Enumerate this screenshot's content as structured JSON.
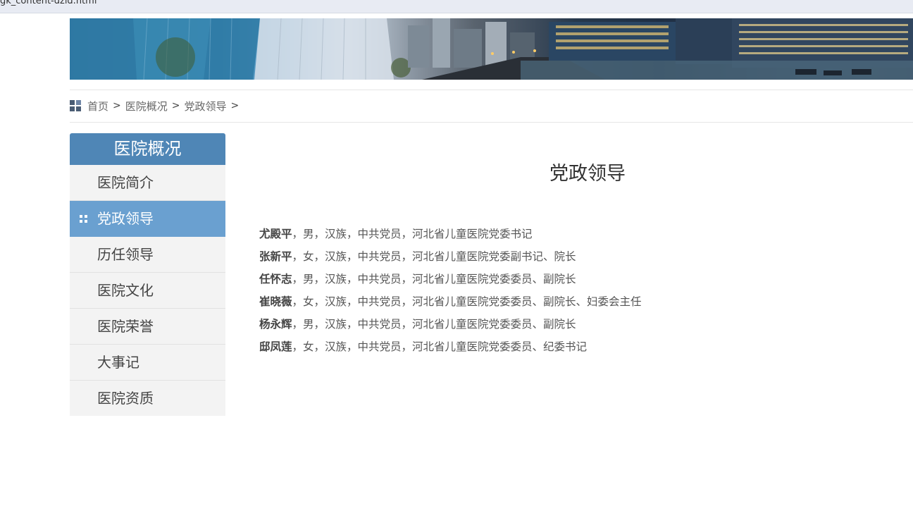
{
  "browser": {
    "url_text": "gk_content-dzld.html"
  },
  "breadcrumb": {
    "items": [
      "首页",
      "医院概况",
      "党政领导"
    ],
    "separator": ">"
  },
  "sidebar": {
    "title": "医院概况",
    "items": [
      {
        "label": "医院简介",
        "active": false
      },
      {
        "label": "党政领导",
        "active": true
      },
      {
        "label": "历任领导",
        "active": false
      },
      {
        "label": "医院文化",
        "active": false
      },
      {
        "label": "医院荣誉",
        "active": false
      },
      {
        "label": "大事记",
        "active": false
      },
      {
        "label": "医院资质",
        "active": false
      }
    ]
  },
  "content": {
    "title": "党政领导",
    "people": [
      {
        "name": "尤殿平",
        "desc": "，男，汉族，中共党员，河北省儿童医院党委书记"
      },
      {
        "name": "张新平",
        "desc": "，女，汉族，中共党员，河北省儿童医院党委副书记、院长"
      },
      {
        "name": "任怀志",
        "desc": "，男，汉族，中共党员，河北省儿童医院党委委员、副院长"
      },
      {
        "name": "崔晓薇",
        "desc": "，女，汉族，中共党员，河北省儿童医院党委委员、副院长、妇委会主任"
      },
      {
        "name": "杨永辉",
        "desc": "，男，汉族，中共党员，河北省儿童医院党委委员、副院长"
      },
      {
        "name": "邸凤莲",
        "desc": "，女，汉族，中共党员，河北省儿童医院党委委员、纪委书记"
      }
    ]
  },
  "colors": {
    "sidebar_header": "#4f86b6",
    "sidebar_active": "#6aa0d0",
    "sidebar_item_bg": "#f3f3f3"
  },
  "icons": {
    "breadcrumb": "grid-icon",
    "active_item": "dots-icon"
  }
}
